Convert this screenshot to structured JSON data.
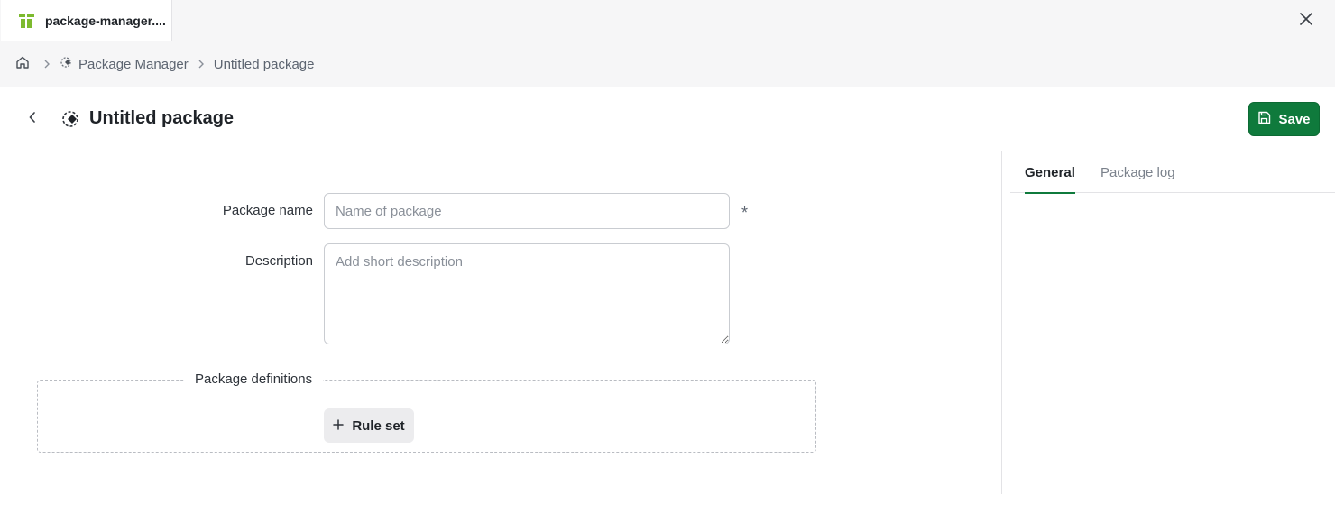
{
  "tab": {
    "label": "package-manager....",
    "icon": "package-manager-icon"
  },
  "window": {
    "close_icon": "close-icon"
  },
  "breadcrumb": {
    "items": [
      {
        "icon": "home-icon",
        "label": ""
      },
      {
        "icon": "package-manager-icon",
        "label": "Package Manager"
      },
      {
        "label": "Untitled package"
      }
    ]
  },
  "header": {
    "title": "Untitled package",
    "icon": "package-manager-icon",
    "save_label": "Save"
  },
  "form": {
    "name_label": "Package name",
    "name_placeholder": "Name of package",
    "name_value": "",
    "required_marker": "*",
    "description_label": "Description",
    "description_placeholder": "Add short description",
    "description_value": "",
    "definitions_legend": "Package definitions",
    "ruleset_label": "Rule set"
  },
  "side_panel": {
    "tabs": [
      {
        "label": "General",
        "active": true
      },
      {
        "label": "Package log",
        "active": false
      }
    ]
  },
  "colors": {
    "accent": "#0f7a3c",
    "brand_icon": "#7dba2f"
  }
}
